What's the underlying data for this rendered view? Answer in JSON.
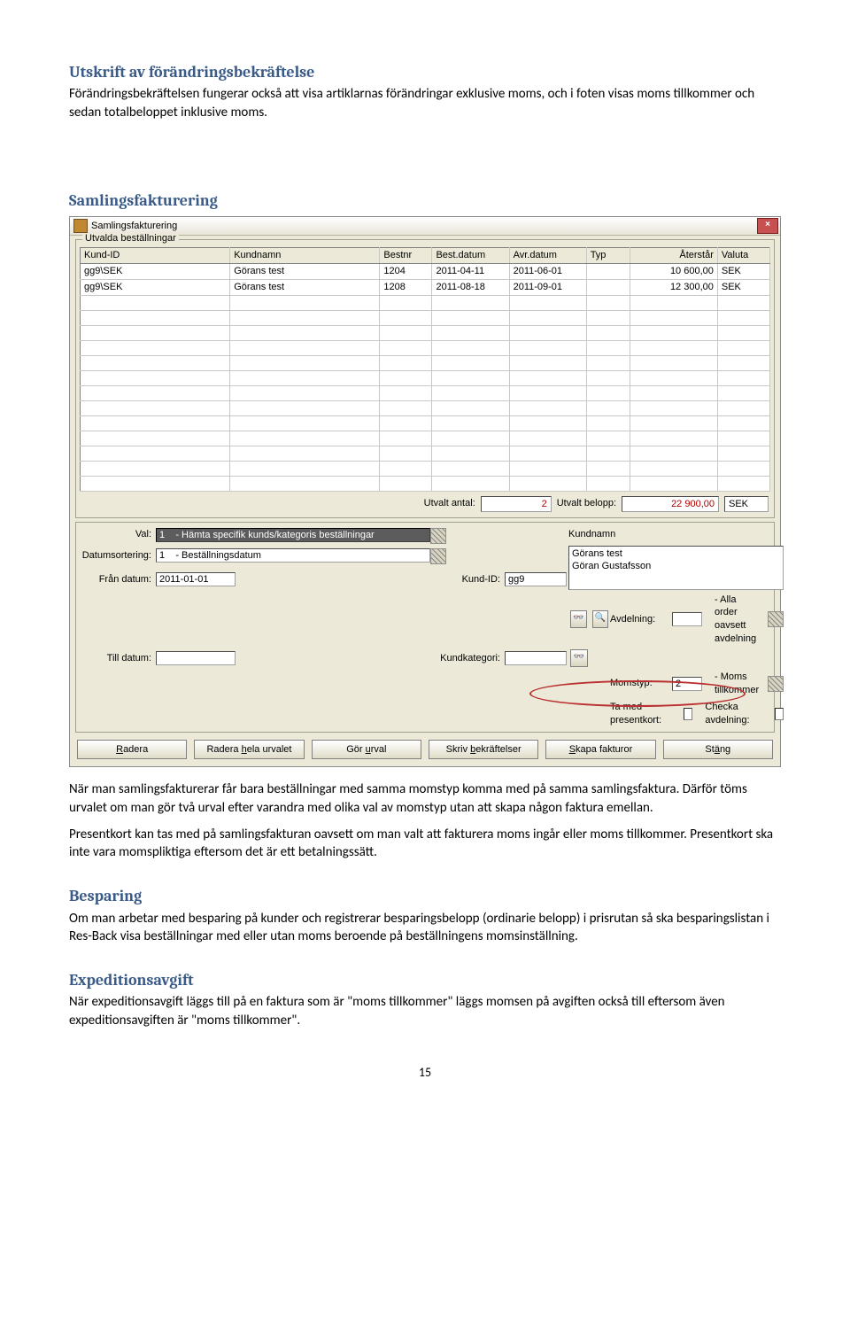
{
  "h1": "Utskrift av förändringsbekräftelse",
  "p1": "Förändringsbekräftelsen fungerar också att visa artiklarnas förändringar exklusive moms, och i foten visas moms tillkommer och sedan totalbeloppet inklusive moms.",
  "h2": "Samlingsfakturering",
  "win": {
    "title": "Samlingsfakturering",
    "group_legend": "Utvalda beställningar",
    "cols": [
      "Kund-ID",
      "Kundnamn",
      "Bestnr",
      "Best.datum",
      "Avr.datum",
      "Typ",
      "Återstår",
      "Valuta"
    ],
    "rows": [
      {
        "kund": "gg9\\SEK",
        "namn": "Görans test",
        "bestnr": "1204",
        "bdat": "2011-04-11",
        "adat": "2011-06-01",
        "typ": "",
        "aterstar": "10 600,00",
        "valuta": "SEK"
      },
      {
        "kund": "gg9\\SEK",
        "namn": "Görans test",
        "bestnr": "1208",
        "bdat": "2011-08-18",
        "adat": "2011-09-01",
        "typ": "",
        "aterstar": "12 300,00",
        "valuta": "SEK"
      }
    ],
    "totals": {
      "antal_label": "Utvalt antal:",
      "antal": "2",
      "belopp_label": "Utvalt belopp:",
      "belopp": "22 900,00",
      "sek": "SEK"
    },
    "filters": {
      "val_label": "Val:",
      "val_value": "1    - Hämta specifik kunds/kategoris beställningar",
      "sort_label": "Datumsortering:",
      "sort_value": "1    - Beställningsdatum",
      "from_label": "Från datum:",
      "from_value": "2011-01-01",
      "till_label": "Till datum:",
      "till_value": "",
      "kundid_label": "Kund-ID:",
      "kundid_value": "gg9",
      "kundkat_label": "Kundkategori:",
      "kundkat_value": "",
      "kundnamn_label": "Kundnamn",
      "kundnamn_line1": "Görans test",
      "kundnamn_line2": "Göran Gustafsson",
      "avd_label": "Avdelning:",
      "avd_value": "",
      "avd_text": "- Alla order oavsett avdelning",
      "moms_label": "Momstyp:",
      "moms_value": "2",
      "moms_text": "- Moms tillkommer",
      "presentkort_label": "Ta med presentkort:",
      "checka_label": "Checka avdelning:"
    },
    "buttons": {
      "radera": "Radera",
      "radera_hela": "Radera hela urvalet",
      "gor_urval": "Gör urval",
      "skriv": "Skriv bekräftelser",
      "skapa": "Skapa fakturor",
      "stang": "Stäng"
    }
  },
  "p2": "När man samlingsfakturerar får bara beställningar med samma momstyp komma med på samma samlingsfaktura. Därför töms urvalet om man gör två urval efter varandra med olika val av momstyp utan att skapa någon faktura emellan.",
  "p3": "Presentkort kan tas med på samlingsfakturan oavsett om man valt att fakturera moms ingår eller moms tillkommer. Presentkort ska inte vara momspliktiga eftersom det är ett betalningssätt.",
  "h3": "Besparing",
  "p4": "Om man arbetar med besparing på kunder och registrerar besparingsbelopp (ordinarie belopp) i prisrutan så ska besparingslistan i Res-Back visa beställningar med eller utan moms beroende på beställningens momsinställning.",
  "h4": "Expeditionsavgift",
  "p5": "När expeditionsavgift läggs till på en faktura som är \"moms tillkommer\" läggs momsen på avgiften också till eftersom även expeditionsavgiften är \"moms tillkommer\".",
  "pagenum": "15"
}
